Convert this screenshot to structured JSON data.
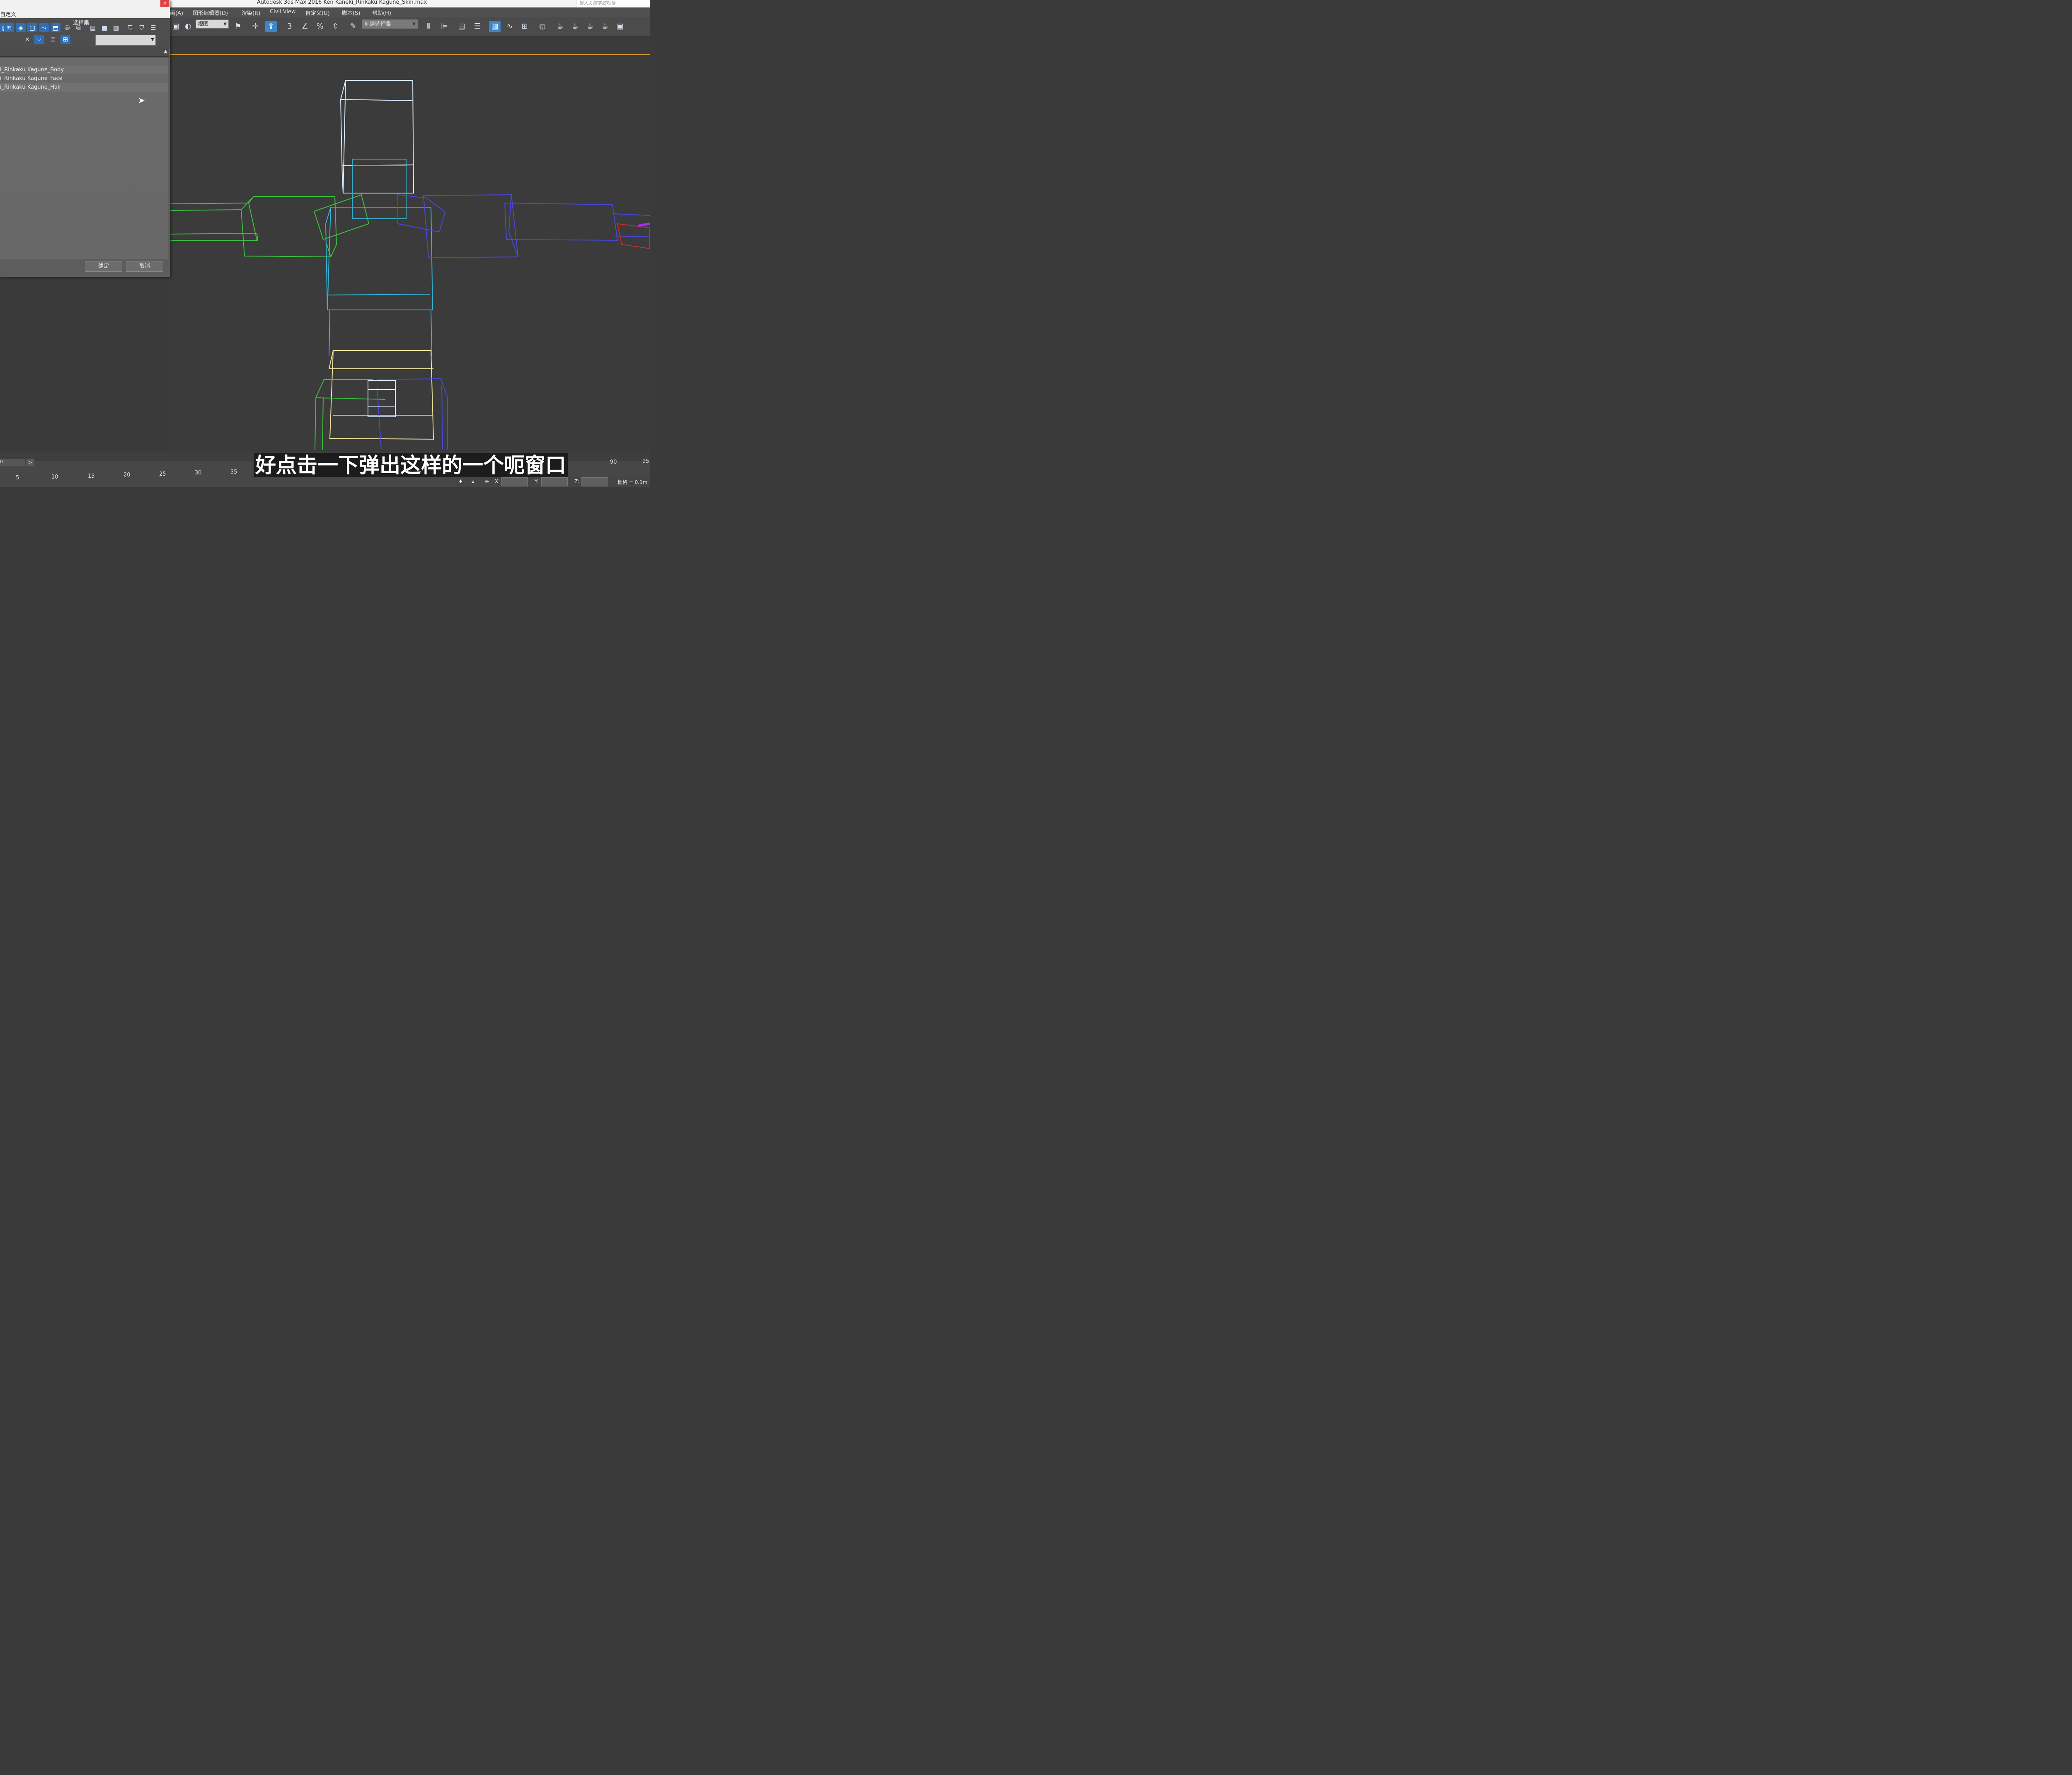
{
  "app": {
    "title": "Autodesk 3ds Max 2016     Ken Kaneki_Rinkaku Kagune_Skin.max",
    "search_placeholder": "键入关键字或短语"
  },
  "menu": {
    "items": [
      "画(A)",
      "图形编辑器(D)",
      "渲染(R)",
      "Civil View",
      "自定义(U)",
      "脚本(S)",
      "帮助(H)"
    ]
  },
  "toolbar": {
    "view_combo": "视图",
    "selection_set_combo": "创建选择集",
    "snap_3": "3",
    "percent": "%"
  },
  "dialog": {
    "title": "自定义",
    "close": "×",
    "selection_set_label": "选择集:",
    "selection_set_value": "",
    "items": [
      "i_Rinkaku Kagune_Body",
      "i_Rinkaku Kagune_Face",
      "i_Rinkaku Kagune_Hair"
    ],
    "ok": "确定",
    "cancel": "取消"
  },
  "timeline": {
    "frame": "0",
    "next": ">",
    "ticks": [
      "5",
      "10",
      "15",
      "20",
      "25",
      "30",
      "35",
      "90",
      "95"
    ]
  },
  "subtitle": "好点击一下弹出这样的一个呃窗口",
  "status": {
    "x_label": "X:",
    "y_label": "Y:",
    "z_label": "Z:",
    "grid": "栅格 = 0.1m"
  },
  "colors": {
    "viewport_bg": "#3b3b3b",
    "active_border": "#d79a2a",
    "green_bones": "#3fbf3f",
    "cyan_bones": "#35b6d8",
    "blue_bones": "#4040d8",
    "white_box": "#d8e8ff",
    "yellow_box": "#f0e2a0"
  }
}
